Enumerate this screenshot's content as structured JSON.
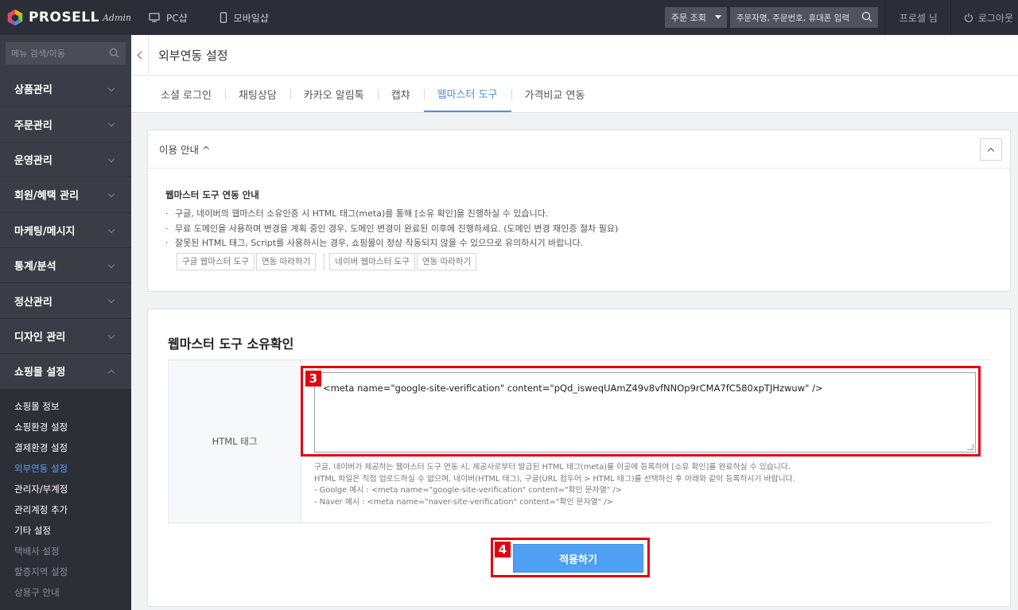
{
  "brand": {
    "name": "PROSELL",
    "sub": "Admin"
  },
  "topnav": [
    {
      "label": "PC샵",
      "icon": "monitor-icon"
    },
    {
      "label": "모바일샵",
      "icon": "mobile-icon"
    }
  ],
  "top_right": {
    "order_select": "주문 조회",
    "order_search_placeholder": "주문자명, 주문번호, 휴대폰 입력",
    "user": "프로셀 님",
    "logout": "로그아웃"
  },
  "sidebar": {
    "search_placeholder": "메뉴 검색/이동",
    "items": [
      "상품관리",
      "주문관리",
      "운영관리",
      "회원/혜택 관리",
      "마케팅/메시지",
      "통계/분석",
      "정산관리",
      "디자인 관리",
      "쇼핑몰 설정"
    ],
    "sub_items": [
      "쇼핑몰 정보",
      "쇼핑환경 설정",
      "결제환경 설정",
      "외부연동 설정",
      "관리자/부계정",
      "관리계정 추가",
      "기타 설정",
      "택배사 설정",
      "할증지역 설정",
      "상용구 안내"
    ],
    "active_sub": "외부연동 설정"
  },
  "page": {
    "title": "외부연동 설정",
    "tabs": [
      "소셜 로그인",
      "채팅상담",
      "카카오 알림톡",
      "캡챠",
      "웹마스터 도구",
      "가격비교 연동"
    ],
    "active_tab": "웹마스터 도구"
  },
  "guide": {
    "head": "이용 안내 ^",
    "title": "웹마스터 도구 연동 안내",
    "lines": [
      "구글, 네이버의 웹마스터 소유인증 시 HTML 태그(meta)를 통해 [소유 확인]을 진행하실 수 있습니다.",
      "무료 도메인을 사용하며 변경을 계획 중인 경우, 도메인 변경이 완료된 이후에 진행하세요. (도메인 변경 재인증 절차 필요)",
      "잘못된 HTML 태그, Script를 사용하시는 경우, 쇼핑몰이 정상 작동되지 않을 수 있으므로 유의하시기 바랍니다."
    ],
    "buttons": [
      "구글 웹마스터 도구",
      "연동 따라하기",
      "네이버 웹마스터 도구",
      "연동 따라하기"
    ]
  },
  "owner": {
    "title": "웹마스터 도구 소유확인",
    "label": "HTML 태그",
    "value": "<meta name=\"google-site-verification\" content=\"pQd_isweqUAmZ49v8vfNNOp9rCMA7fC580xpTJHzwuw\" />",
    "help": [
      "구글, 네이버가 제공하는 웹마스터 도구 연동 시, 제공사로부터 발급된 HTML 태그(meta)를 이곳에 등록하여 [소유 확인]를 완료하실 수 있습니다.",
      "HTML 파일은 직접 업로드하실 수 없으며, 네이버(HTML 태그), 구글(URL 접두어 > HTML 태그)를 선택하신 후 아래와 같이 등록하시기 바랍니다.",
      "- Goolge 예시 : <meta name=\"google-site-verification\" content=\"확인 문자열\" />",
      "- Naver 예시 : <meta name=\"naver-site-verification\" content=\"확인 문자열\" />"
    ],
    "apply": "적용하기"
  },
  "annotations": {
    "step3": "3",
    "step4": "4",
    "color": "#e3000f"
  }
}
